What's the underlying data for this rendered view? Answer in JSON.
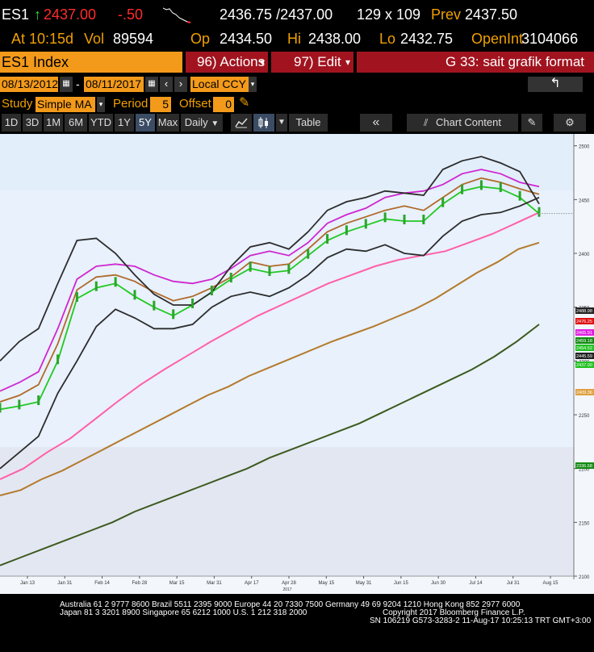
{
  "quote": {
    "ticker": "ES1",
    "last": "2437.00",
    "change": "-.50",
    "bid_ask": "2436.75 /2437.00",
    "size": "129 x 109",
    "prev_label": "Prev",
    "prev": "2437.50",
    "at_label": "At",
    "time": "10:15d",
    "vol_label": "Vol",
    "vol": "89594",
    "op_label": "Op",
    "open": "2434.50",
    "hi_label": "Hi",
    "high": "2438.00",
    "lo_label": "Lo",
    "low": "2432.75",
    "oi_label": "OpenInt",
    "open_interest": "3104066"
  },
  "command_bar": {
    "security": "ES1 Index",
    "actions": "96) Actions",
    "edit": "97) Edit",
    "title": "G 33: sait grafik format"
  },
  "range": {
    "start": "08/13/2012",
    "end": "08/11/2017",
    "currency": "Local CCY"
  },
  "study": {
    "label": "Study",
    "type": "Simple MA",
    "period_label": "Period",
    "period": "5",
    "offset_label": "Offset",
    "offset": "0"
  },
  "toolbar": {
    "ranges": [
      "1D",
      "3D",
      "1M",
      "6M",
      "YTD",
      "1Y",
      "5Y",
      "Max"
    ],
    "active_range": "5Y",
    "frequency": "Daily",
    "table": "Table",
    "chart_content": "Chart Content"
  },
  "chart_data": {
    "type": "line",
    "x_ticks": [
      "Jan 13",
      "Jan 31",
      "Feb 14",
      "Feb 28",
      "Mar 15",
      "Mar 31",
      "Apr 17",
      "Apr 28",
      "May 15",
      "May 31",
      "Jun 15",
      "Jun 30",
      "Jul 14",
      "Jul 31",
      "Aug 15"
    ],
    "x_sub_label": "2017",
    "y_ticks": [
      2500,
      2450,
      2400,
      2350,
      2300,
      2250,
      2200,
      2150,
      2100
    ],
    "ylim": [
      2100,
      2505
    ],
    "price_labels": [
      {
        "value": "2488.98",
        "color": "#222222"
      },
      {
        "value": "2476.25",
        "color": "#e01010"
      },
      {
        "value": "2465.91",
        "color": "#e020e0"
      },
      {
        "value": "2459.18",
        "color": "#138a13"
      },
      {
        "value": "2454.52",
        "color": "#21c121"
      },
      {
        "value": "2445.59",
        "color": "#222222"
      },
      {
        "value": "2437.00",
        "color": "#21c121"
      },
      {
        "value": "2409.36",
        "color": "#e0a040"
      },
      {
        "value": "2336.68",
        "color": "#138a13"
      }
    ],
    "series": [
      {
        "color": "#ff5fa8",
        "values": [
          2190,
          2200,
          2215,
          2228,
          2245,
          2262,
          2278,
          2292,
          2305,
          2318,
          2330,
          2342,
          2352,
          2362,
          2372,
          2380,
          2388,
          2394,
          2398,
          2402,
          2410,
          2418,
          2428,
          2438
        ]
      },
      {
        "color": "#b47a2c",
        "values": [
          2175,
          2180,
          2190,
          2198,
          2208,
          2218,
          2228,
          2238,
          2248,
          2258,
          2268,
          2276,
          2286,
          2294,
          2302,
          2310,
          2318,
          2325,
          2332,
          2340,
          2348,
          2358,
          2370,
          2382,
          2392,
          2404,
          2410
        ]
      },
      {
        "color": "#3d5a1e",
        "values": [
          2110,
          2118,
          2126,
          2134,
          2142,
          2150,
          2160,
          2168,
          2176,
          2184,
          2192,
          2200,
          2210,
          2218,
          2226,
          2234,
          2242,
          2252,
          2262,
          2272,
          2282,
          2292,
          2304,
          2318,
          2334
        ]
      },
      {
        "color": "#d026d0",
        "values": [
          2272,
          2280,
          2290,
          2330,
          2376,
          2388,
          2390,
          2388,
          2380,
          2374,
          2372,
          2376,
          2386,
          2398,
          2402,
          2398,
          2410,
          2428,
          2436,
          2442,
          2452,
          2456,
          2458,
          2464,
          2474,
          2478,
          2474,
          2466,
          2462
        ]
      },
      {
        "color": "#b06a2a",
        "values": [
          2262,
          2268,
          2278,
          2316,
          2366,
          2378,
          2380,
          2374,
          2364,
          2356,
          2360,
          2368,
          2378,
          2392,
          2388,
          2390,
          2404,
          2420,
          2428,
          2434,
          2440,
          2444,
          2440,
          2452,
          2464,
          2470,
          2466,
          2460,
          2455
        ]
      },
      {
        "color": "#22c822",
        "values": [
          2255,
          2258,
          2262,
          2300,
          2358,
          2368,
          2372,
          2360,
          2350,
          2342,
          2352,
          2364,
          2376,
          2386,
          2382,
          2384,
          2398,
          2412,
          2420,
          2426,
          2432,
          2430,
          2430,
          2446,
          2458,
          2462,
          2460,
          2452,
          2437
        ]
      },
      {
        "color": "#2c2c2c",
        "values": [
          2300,
          2318,
          2330,
          2372,
          2412,
          2414,
          2400,
          2380,
          2362,
          2352,
          2352,
          2364,
          2388,
          2406,
          2410,
          2404,
          2420,
          2440,
          2448,
          2452,
          2458,
          2456,
          2454,
          2478,
          2486,
          2490,
          2484,
          2476,
          2446
        ]
      },
      {
        "color": "#2c2c2c",
        "values": [
          2200,
          2215,
          2230,
          2270,
          2300,
          2332,
          2348,
          2340,
          2330,
          2330,
          2334,
          2350,
          2360,
          2364,
          2360,
          2368,
          2380,
          2396,
          2404,
          2402,
          2408,
          2400,
          2398,
          2416,
          2430,
          2436,
          2438,
          2444,
          2452
        ]
      }
    ],
    "last_value": "2437.00"
  },
  "footer": {
    "line1": "Australia 61 2 9777 8600 Brazil 5511 2395 9000 Europe 44 20 7330 7500 Germany 49 69 9204 1210 Hong Kong 852 2977 6000",
    "line2_left": "Japan 81 3 3201 8900          Singapore 65 6212 1000          U.S. 1 212 318 2000",
    "line2_right": "Copyright 2017 Bloomberg Finance L.P.",
    "line3": "SN 106219 G573-3283-2 11-Aug-17 10:25:13 TRT  GMT+3:00"
  }
}
